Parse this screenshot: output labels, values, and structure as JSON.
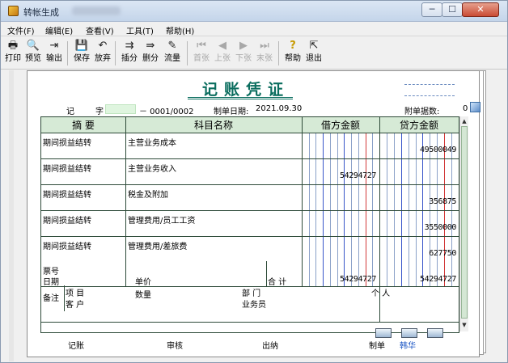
{
  "window": {
    "title": "转帐生成"
  },
  "menu": [
    {
      "label": "文件(F)"
    },
    {
      "label": "编辑(E)"
    },
    {
      "label": "查看(V)"
    },
    {
      "label": "工具(T)"
    },
    {
      "label": "帮助(H)"
    }
  ],
  "toolbar": [
    {
      "label": "打印",
      "icon": "printer-icon",
      "glyph": "🖶",
      "enabled": true
    },
    {
      "label": "预览",
      "icon": "preview-icon",
      "glyph": "🔍",
      "enabled": true
    },
    {
      "label": "输出",
      "icon": "export-icon",
      "glyph": "⇥",
      "enabled": true
    },
    {
      "label": "保存",
      "icon": "save-icon",
      "glyph": "💾",
      "enabled": true
    },
    {
      "label": "放弃",
      "icon": "undo-icon",
      "glyph": "↶",
      "enabled": true
    },
    {
      "label": "插分",
      "icon": "insert-entry-icon",
      "glyph": "⇉",
      "enabled": true
    },
    {
      "label": "删分",
      "icon": "delete-entry-icon",
      "glyph": "⇛",
      "enabled": true
    },
    {
      "label": "流量",
      "icon": "cashflow-icon",
      "glyph": "✎",
      "enabled": true
    },
    {
      "label": "首张",
      "icon": "first-icon",
      "glyph": "⏮",
      "enabled": false
    },
    {
      "label": "上张",
      "icon": "prev-icon",
      "glyph": "◀",
      "enabled": false
    },
    {
      "label": "下张",
      "icon": "next-icon",
      "glyph": "▶",
      "enabled": false
    },
    {
      "label": "末张",
      "icon": "last-icon",
      "glyph": "⏭",
      "enabled": false
    },
    {
      "label": "帮助",
      "icon": "help-icon",
      "glyph": "?",
      "enabled": true
    },
    {
      "label": "退出",
      "icon": "exit-icon",
      "glyph": "⇱",
      "enabled": true
    }
  ],
  "voucher": {
    "title": "记账凭证",
    "word_label": "记",
    "word_suffix": "字",
    "number": "－ 0001/0002",
    "date_label": "制单日期:",
    "date": "2021.09.30",
    "attach_label": "附单据数:",
    "attach_count": "0",
    "columns": {
      "summary": "摘 要",
      "account": "科目名称",
      "debit": "借方金额",
      "credit": "贷方金额"
    },
    "rows": [
      {
        "summary": "期间损益结转",
        "account": "主营业务成本",
        "debit": "",
        "credit": "49500049"
      },
      {
        "summary": "期间损益结转",
        "account": "主营业务收入",
        "debit": "54294727",
        "credit": ""
      },
      {
        "summary": "期间损益结转",
        "account": "税金及附加",
        "debit": "",
        "credit": "356875"
      },
      {
        "summary": "期间损益结转",
        "account": "管理费用/员工工资",
        "debit": "",
        "credit": "3550000"
      },
      {
        "summary": "期间损益结转",
        "account": "管理费用/差旅费",
        "debit": "",
        "credit": "627750"
      }
    ],
    "footer": {
      "ticket_label": "票号",
      "date_label": "日期",
      "price_label": "单价",
      "qty_label": "数量",
      "total_label": "合 计",
      "debit_total": "54294727",
      "credit_total": "54294727"
    },
    "notes": {
      "remark_label": "备注",
      "project_label": "项  目",
      "customer_label": "客  户",
      "dept_label": "部  门",
      "staff_label": "业务员",
      "person_label": "个  人"
    },
    "signatures": {
      "posting_label": "记账",
      "review_label": "审核",
      "cashier_label": "出纳",
      "maker_label": "制单",
      "maker_name": "韩华"
    }
  },
  "colors": {
    "title_green": "#0a6d5e",
    "header_bg": "#d6ead6",
    "grid_line": "#2d4a38",
    "money_blue": "#3a56c9",
    "money_red": "#d23a3a",
    "maker_name": "#1a55c4"
  }
}
